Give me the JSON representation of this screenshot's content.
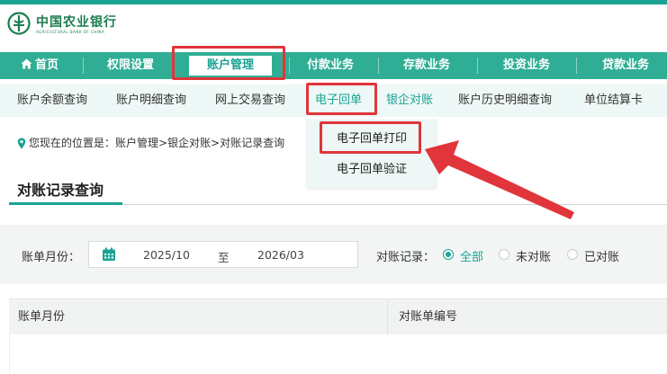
{
  "brand": {
    "name_cn": "中国农业银行",
    "name_en": "AGRICULTURAL BANK OF CHINA",
    "color": "#1a7d4e"
  },
  "colors": {
    "accent": "#1aa394",
    "nav_bg": "#2fae95",
    "highlight": "#e0353a"
  },
  "main_nav": {
    "items": [
      {
        "label": "首页",
        "icon": "home-icon"
      },
      {
        "label": "权限设置"
      },
      {
        "label": "账户管理",
        "active": true
      },
      {
        "label": "付款业务"
      },
      {
        "label": "存款业务"
      },
      {
        "label": "投资业务"
      },
      {
        "label": "贷款业务"
      }
    ]
  },
  "sub_nav": {
    "items": [
      {
        "label": "账户余额查询"
      },
      {
        "label": "账户明细查询"
      },
      {
        "label": "网上交易查询"
      },
      {
        "label": "电子回单",
        "active": true
      },
      {
        "label": "银企对账"
      },
      {
        "label": "账户历史明细查询"
      },
      {
        "label": "单位结算卡"
      }
    ]
  },
  "dropdown": {
    "items": [
      {
        "label": "电子回单打印",
        "highlighted": true
      },
      {
        "label": "电子回单验证"
      }
    ]
  },
  "breadcrumb": {
    "text": "您现在的位置是：账户管理>银企对账>对账记录查询"
  },
  "page": {
    "title": "对账记录查询"
  },
  "filter": {
    "month_label": "账单月份：",
    "start": "2025/10",
    "to": "至",
    "end": "2026/03",
    "record_label": "对账记录：",
    "options": [
      {
        "label": "全部",
        "selected": true
      },
      {
        "label": "未对账",
        "selected": false
      },
      {
        "label": "已对账",
        "selected": false
      }
    ]
  },
  "table": {
    "columns": [
      "账单月份",
      "对账单编号"
    ],
    "rows": []
  }
}
